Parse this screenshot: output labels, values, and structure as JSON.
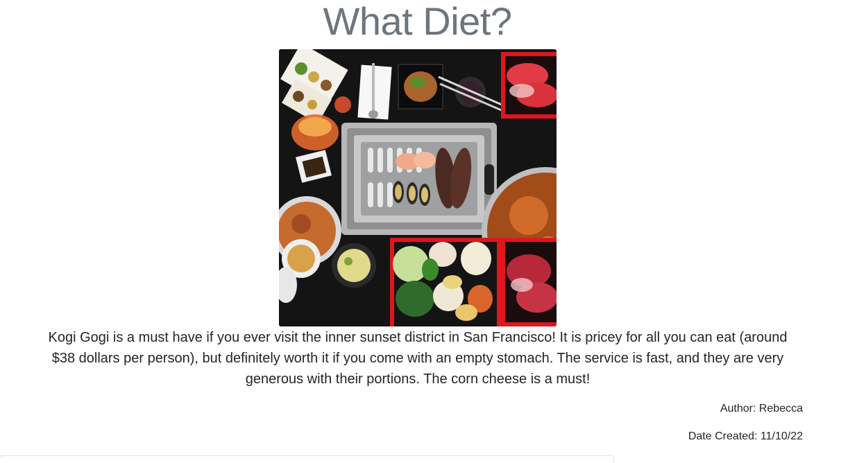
{
  "post": {
    "title": "What Diet?",
    "image_alt": "Korean BBQ and hot pot spread",
    "body": "Kogi Gogi is a must have if you ever visit the inner sunset district in San Francisco! It is pricey for all you can eat (around $38 dollars per person), but definitely worth it if you come with an empty stomach. The service is fast, and they are very generous with their portions. The corn cheese is a must!",
    "author_line": "Author: Rebecca",
    "date_line": "Date Created: 11/10/22"
  }
}
